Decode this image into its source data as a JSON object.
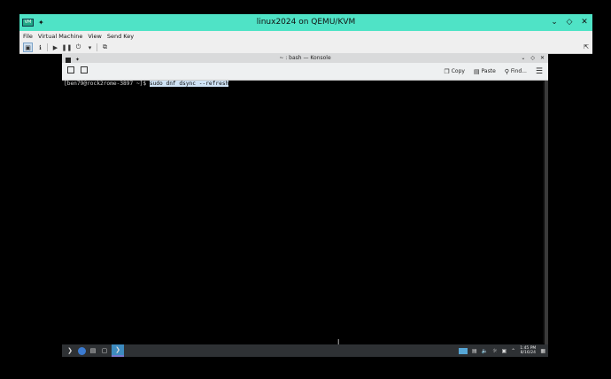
{
  "window": {
    "title": "linux2024 on QEMU/KVM",
    "icon": "virt-manager-app-icon",
    "pin_icon": "pin-icon",
    "controls": [
      "chevron-down-icon",
      "diamond-icon",
      "close-icon"
    ]
  },
  "menubar": {
    "items": [
      "File",
      "Virtual Machine",
      "View",
      "Send Key"
    ]
  },
  "toolbar": {
    "icons": [
      "console-view-icon",
      "details-view-icon",
      "play-icon",
      "pause-icon",
      "power-icon",
      "dropdown-icon",
      "snapshot-icon"
    ],
    "fullscreen_icon": "fullscreen-icon"
  },
  "konsole": {
    "title": "~ : bash — Konsole",
    "new_tab_icon": "new-tab-icon",
    "split_view_icon": "split-view-icon",
    "copy_label": "Copy",
    "paste_label": "Paste",
    "find_label": "Find...",
    "menu_icon": "hamburger-menu-icon"
  },
  "terminal": {
    "prompt": "[ben79@rock2rome-3897 ~]$ ",
    "command": "sudo dnf dsync --refresh"
  },
  "panel": {
    "clock_time": "1:45 PM",
    "clock_date": "8/16/24",
    "icons": [
      "application-launcher-icon",
      "firefox-icon",
      "taskbar-icon",
      "file-manager-icon",
      "konsole-icon"
    ],
    "tray_icons": [
      "clipboard-icon",
      "volume-icon",
      "brightness-icon",
      "network-icon",
      "expand-tray-icon"
    ]
  }
}
